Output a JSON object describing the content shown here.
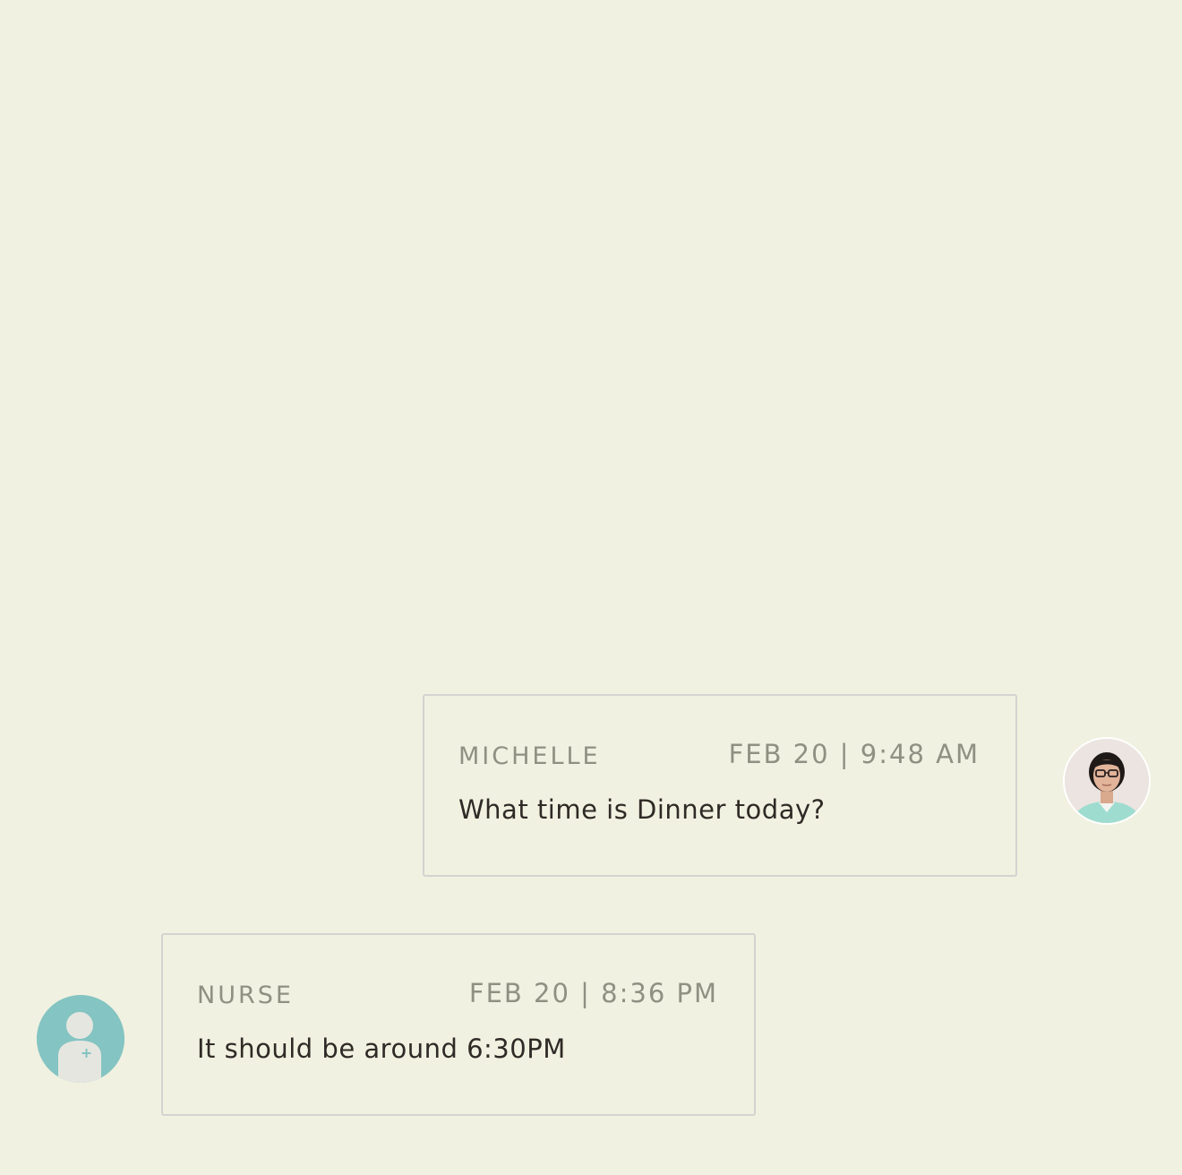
{
  "colors": {
    "background": "#f1f1e1",
    "bubble_border": "#d3d3d0",
    "meta_text": "#8f8f82",
    "body_text": "#2f2a26",
    "nurse_avatar": "#84c4c2"
  },
  "messages": [
    {
      "sender": "MICHELLE",
      "timestamp": "FEB 20 | 9:48 AM",
      "text": "What time is Dinner today?",
      "avatar": "user-photo-avatar"
    },
    {
      "sender": "NURSE",
      "timestamp": "FEB 20 | 8:36 PM",
      "text": "It should be around 6:30PM",
      "avatar": "nurse-avatar-icon"
    }
  ]
}
